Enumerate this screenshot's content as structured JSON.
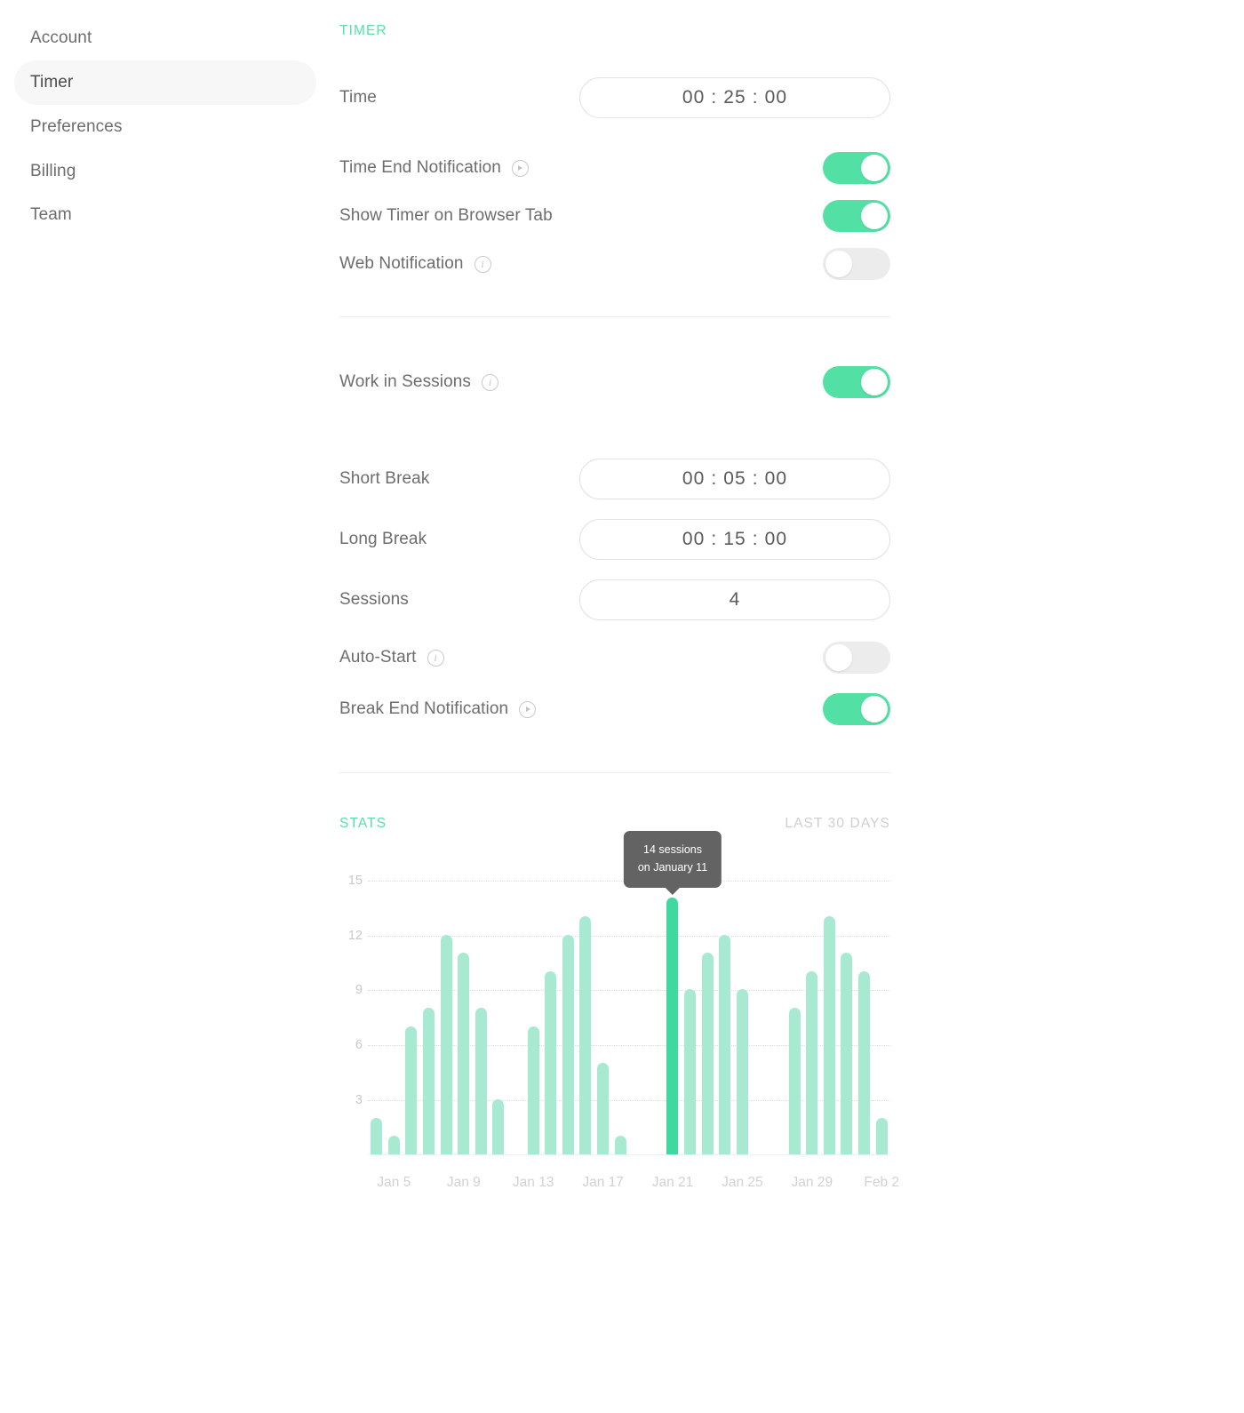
{
  "sidebar": {
    "items": [
      {
        "label": "Account",
        "active": false
      },
      {
        "label": "Timer",
        "active": true
      },
      {
        "label": "Preferences",
        "active": false
      },
      {
        "label": "Billing",
        "active": false
      },
      {
        "label": "Team",
        "active": false
      }
    ]
  },
  "colors": {
    "accent": "#55e0a7",
    "toggle_on": "#52e0a5",
    "toggle_off": "#ececec",
    "bar": "#a8ead1",
    "bar_highlight": "#3ed9a0",
    "tooltip_bg": "#636363",
    "text": "#6d6d6d",
    "muted": "#cfcfcf"
  },
  "timer_section": {
    "title": "TIMER",
    "time": {
      "label": "Time",
      "value": "00 : 25 : 00"
    },
    "toggles": [
      {
        "label": "Time End Notification",
        "icon": "play-icon",
        "state": "on"
      },
      {
        "label": "Show Timer on Browser Tab",
        "icon": null,
        "state": "on"
      },
      {
        "label": "Web Notification",
        "icon": "info-icon",
        "state": "off"
      }
    ]
  },
  "sessions_section": {
    "work_in_sessions": {
      "label": "Work in Sessions",
      "icon": "info-icon",
      "state": "on"
    },
    "fields": [
      {
        "label": "Short Break",
        "value": "00 : 05 : 00"
      },
      {
        "label": "Long Break",
        "value": "00 : 15 : 00"
      },
      {
        "label": "Sessions",
        "value": "4"
      }
    ],
    "toggles": [
      {
        "label": "Auto-Start",
        "icon": "info-icon",
        "state": "off"
      },
      {
        "label": "Break End Notification",
        "icon": "play-icon",
        "state": "on"
      }
    ]
  },
  "stats_section": {
    "title": "STATS",
    "range_label": "LAST 30 DAYS",
    "tooltip": {
      "line1": "14 sessions",
      "line2": "on January 11",
      "bar_index": 7
    }
  },
  "chart_data": {
    "type": "bar",
    "title": "STATS",
    "xlabel": "",
    "ylabel": "",
    "ylim": [
      0,
      16
    ],
    "yticks": [
      3,
      6,
      9,
      12,
      15
    ],
    "grid": true,
    "legend": false,
    "categories": [
      "Jan 4",
      "Jan 5",
      "Jan 6",
      "Jan 7",
      "Jan 8",
      "Jan 9",
      "Jan 10",
      "Jan 11",
      "Jan 12",
      "Jan 13",
      "Jan 14",
      "Jan 15",
      "Jan 16",
      "Jan 17",
      "Jan 18",
      "Jan 19",
      "Jan 20",
      "Jan 21",
      "Jan 22",
      "Jan 23",
      "Jan 24",
      "Jan 25",
      "Jan 26",
      "Jan 27",
      "Jan 28",
      "Jan 29",
      "Jan 30",
      "Jan 31",
      "Feb 1",
      "Feb 2"
    ],
    "values": [
      2,
      1,
      7,
      8,
      12,
      11,
      8,
      3,
      0,
      7,
      10,
      12,
      13,
      5,
      1,
      0,
      0,
      14,
      9,
      11,
      12,
      9,
      0,
      0,
      8,
      10,
      13,
      11,
      10,
      2
    ],
    "highlight_index": 17,
    "highlight_value": 14,
    "xtick_labels": [
      "Jan 5",
      "Jan 9",
      "Jan 13",
      "Jan 17",
      "Jan 21",
      "Jan 25",
      "Jan 29",
      "Feb 2"
    ],
    "xtick_indices": [
      1,
      5,
      9,
      13,
      17,
      21,
      25,
      29
    ]
  }
}
